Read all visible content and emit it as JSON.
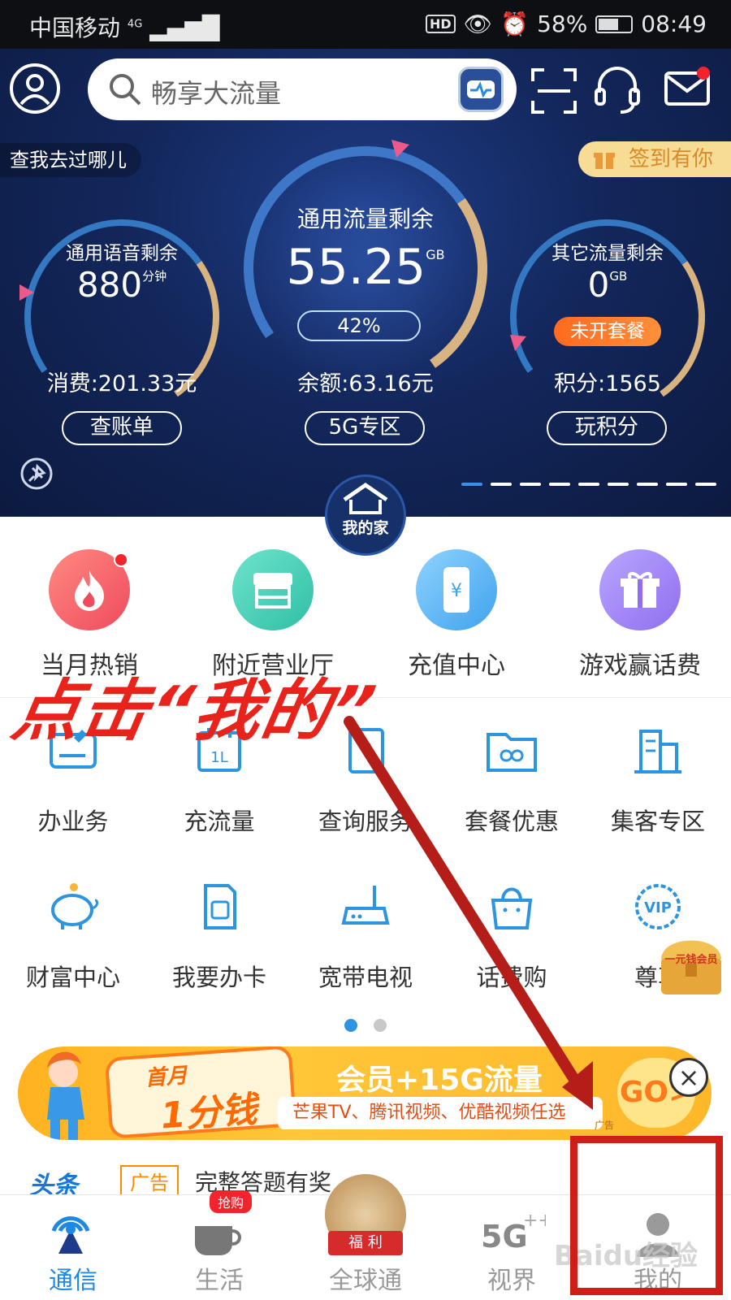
{
  "status_bar": {
    "carrier": "中国移动",
    "signal": "4G",
    "hd": "HD",
    "battery": "58%",
    "time": "08:49"
  },
  "header": {
    "search_placeholder": "畅享大流量"
  },
  "hero": {
    "footprint": "查我去过哪儿",
    "signin": "签到有你",
    "voice": {
      "title": "通用语音剩余",
      "value": "880",
      "unit": "分钟"
    },
    "data_main": {
      "title": "通用流量剩余",
      "value": "55.25",
      "unit": "GB",
      "percent": "42%"
    },
    "data_other": {
      "title": "其它流量剩余",
      "value": "0",
      "unit": "GB",
      "badge": "未开套餐"
    },
    "spend": "消费:201.33元",
    "balance": "余额:63.16元",
    "points": "积分:1565",
    "btn_bill": "查账单",
    "btn_5g": "5G专区",
    "btn_points": "玩积分"
  },
  "home_badge": "我的家",
  "quick": [
    {
      "label": "当月热销",
      "color": "#f2606a"
    },
    {
      "label": "附近营业厅",
      "color": "#3fd1b7"
    },
    {
      "label": "充值中心",
      "color": "#5eb8f2"
    },
    {
      "label": "游戏赢话费",
      "color": "#9f7ff0"
    }
  ],
  "grid_row1": [
    "办业务",
    "充流量",
    "查询服务",
    "套餐优惠",
    "集客专区"
  ],
  "grid_row2": [
    "财富中心",
    "我要办卡",
    "宽带电视",
    "话费购",
    "尊享"
  ],
  "floating_ad": "一元钱会员",
  "banner": {
    "badge_top": "首月",
    "badge_main": "1分钱",
    "title": "会员+15G流量",
    "subtitle": "芒果TV、腾讯视频、优酷视频任选",
    "go": "GO>",
    "ad_tag": "广告"
  },
  "news": {
    "source": "头条",
    "tag": "广告",
    "text": "完整答题有奖"
  },
  "nav": [
    {
      "label": "通信",
      "active": true
    },
    {
      "label": "生活",
      "badge": "抢购"
    },
    {
      "label": "全球通",
      "badge": "福 利"
    },
    {
      "label": "视界"
    },
    {
      "label": "我的"
    }
  ],
  "annotation": "点击“我的”",
  "watermark": "Baidu经验",
  "colors": {
    "accent": "#1e88e5",
    "annotation": "#e8231c"
  }
}
